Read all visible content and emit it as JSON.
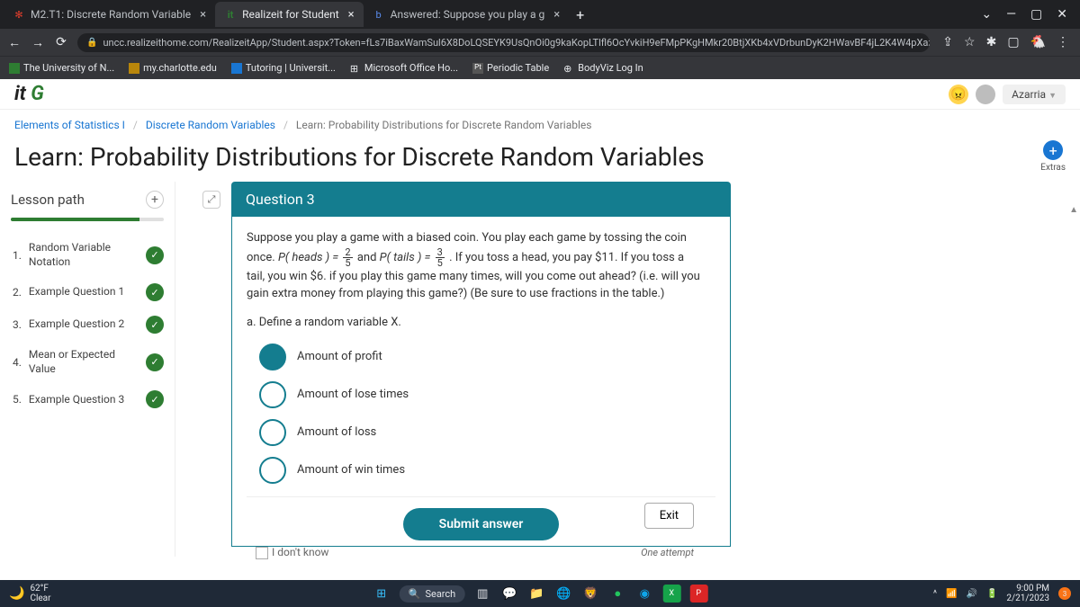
{
  "browser": {
    "tabs": [
      {
        "label": "M2.T1: Discrete Random Variable"
      },
      {
        "label": "Realizeit for Student"
      },
      {
        "label": "Answered: Suppose you play a g"
      }
    ],
    "url": "uncc.realizeithome.com/RealizeitApp/Student.aspx?Token=fLs7iBaxWamSul6X8DoLQSEYK9UsQnOi0g9kaKopLTlfl6OcYvkiH9eFMpPKgHMkr20BtjXKb4xVDrbunDyK2HWavBF4jL2K4W4pXaznaQ...",
    "bookmarks": [
      "The University of N...",
      "my.charlotte.edu",
      "Tutoring | Universit...",
      "Microsoft Office Ho...",
      "Periodic Table",
      "BodyViz Log In"
    ]
  },
  "app": {
    "logo_it": "it",
    "logo_g": "G",
    "user": "Azarria",
    "breadcrumb": {
      "a": "Elements of Statistics I",
      "b": "Discrete Random Variables",
      "c": "Learn: Probability Distributions for Discrete Random Variables"
    },
    "page_title": "Learn: Probability Distributions for Discrete Random Variables",
    "extras": "Extras"
  },
  "sidebar": {
    "title": "Lesson path",
    "items": [
      {
        "num": "1.",
        "label": "Random Variable Notation"
      },
      {
        "num": "2.",
        "label": "Example Question 1"
      },
      {
        "num": "3.",
        "label": "Example Question 2"
      },
      {
        "num": "4.",
        "label": "Mean or Expected Value"
      },
      {
        "num": "5.",
        "label": "Example Question 3"
      }
    ]
  },
  "question": {
    "header": "Question 3",
    "prompt_1": "Suppose you play a game with a biased coin. You play each game by tossing the coin",
    "prompt_2a": "once. ",
    "prompt_heads": "P( heads ) = ",
    "frac1_n": "2",
    "frac1_d": "5",
    "prompt_mid": " and ",
    "prompt_tails": "P( tails ) = ",
    "frac2_n": "3",
    "frac2_d": "5",
    "prompt_2b": ". If you toss a head, you pay $11. If you toss a",
    "prompt_3": "tail, you win $6. if you play this game many times, will you come out ahead? (i.e. will you gain extra money from playing this game?)  (Be sure to use fractions in the table.)",
    "sub": "a. Define a random variable X.",
    "options": [
      "Amount of profit",
      "Amount of lose times",
      "Amount of loss",
      "Amount of win times"
    ],
    "submit": "Submit answer",
    "exit": "Exit",
    "idk": "I don't know",
    "attempt": "One attempt"
  },
  "taskbar": {
    "temp": "62°F",
    "cond": "Clear",
    "search": "Search",
    "time": "9:00 PM",
    "date": "2/21/2023"
  }
}
